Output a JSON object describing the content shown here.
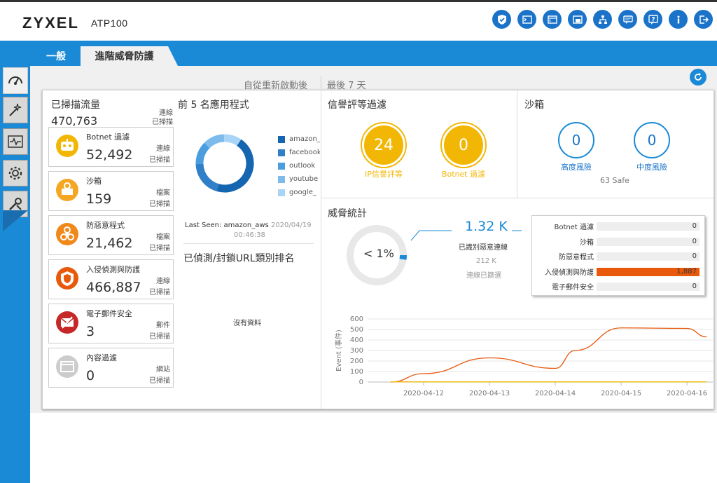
{
  "header": {
    "brand": "ZYXEL",
    "model": "ATP100"
  },
  "top_icons": [
    "shield-check-icon",
    "console-icon",
    "cli-icon",
    "window-icon",
    "network-icon",
    "chat-icon",
    "help-icon",
    "info-icon",
    "logout-icon"
  ],
  "tabs": [
    {
      "label": "一般"
    },
    {
      "label": "進階威脅防護"
    }
  ],
  "sidebar": [
    "dashboard-icon",
    "wizard-icon",
    "monitor-icon",
    "config-icon",
    "maintenance-icon"
  ],
  "toolbar": {
    "since_restart": "自從重新啟動後",
    "period": "最後 7 天"
  },
  "scanned": {
    "title": "已掃描流量",
    "total": "470,763",
    "total_unit": "連線",
    "total_unit2": "已掃描",
    "cards": [
      {
        "name": "Botnet 過濾",
        "value": "52,492",
        "unit": "連線",
        "unit2": "已掃描",
        "color": "#f2b705",
        "icon": "robot-icon"
      },
      {
        "name": "沙箱",
        "value": "159",
        "unit": "檔案",
        "unit2": "已掃描",
        "color": "#f5a623",
        "icon": "sandbox-icon"
      },
      {
        "name": "防惡意程式",
        "value": "21,462",
        "unit": "檔案",
        "unit2": "已掃描",
        "color": "#f0881a",
        "icon": "biohazard-icon"
      },
      {
        "name": "入侵偵測與防護",
        "value": "466,887",
        "unit": "連線",
        "unit2": "已掃描",
        "color": "#e8590c",
        "icon": "ids-shield-icon"
      },
      {
        "name": "電子郵件安全",
        "value": "3",
        "unit": "郵件",
        "unit2": "已掃描",
        "color": "#c62828",
        "icon": "mail-security-icon"
      },
      {
        "name": "內容過濾",
        "value": "0",
        "unit": "網站",
        "unit2": "已掃描",
        "color": "#cccccc",
        "icon": "content-filter-icon"
      }
    ]
  },
  "top_apps": {
    "title": "前 5 名應用程式",
    "legend": [
      {
        "label": "amazon_",
        "color": "#1565b0"
      },
      {
        "label": "facebook",
        "color": "#2f80c8"
      },
      {
        "label": "outlook",
        "color": "#4a9ee0"
      },
      {
        "label": "youtube",
        "color": "#7cbbec"
      },
      {
        "label": "google_",
        "color": "#a9d4f5"
      }
    ],
    "last_seen_label": "Last Seen: amazon_aws",
    "last_seen_date": "2020/04/19",
    "last_seen_time": "00:46:38"
  },
  "url_rank": {
    "title": "已偵測/封鎖URL類別排名",
    "empty": "沒有資料"
  },
  "reputation": {
    "title": "信譽評等過濾",
    "ip_value": "24",
    "ip_label": "IP信譽評等",
    "botnet_value": "0",
    "botnet_label": "Botnet 過濾"
  },
  "sandbox": {
    "title": "沙箱",
    "high_value": "0",
    "high_label": "高度風險",
    "medium_value": "0",
    "medium_label": "中度風險",
    "safe": "63 Safe"
  },
  "threat_stats": {
    "title": "威脅統計",
    "percent": "< 1%",
    "malicious": "1.32 K",
    "malicious_label": "已識別惡意連線",
    "filtered": "212 K",
    "filtered_label": "連線已篩選",
    "bars": [
      {
        "label": "Botnet 過濾",
        "value": "0",
        "fill": 0
      },
      {
        "label": "沙箱",
        "value": "0",
        "fill": 0
      },
      {
        "label": "防惡意程式",
        "value": "0",
        "fill": 0
      },
      {
        "label": "入侵偵測與防護",
        "value": "1,887",
        "fill": 1.0
      },
      {
        "label": "電子郵件安全",
        "value": "0",
        "fill": 0
      }
    ]
  },
  "chart_data": {
    "type": "line",
    "ylabel": "Event (事件)",
    "xlabel": "",
    "ylim": [
      0,
      600
    ],
    "yticks": [
      "0",
      "100",
      "200",
      "300",
      "400",
      "500",
      "600"
    ],
    "categories": [
      "2020-04-12",
      "2020-04-13",
      "2020-04-14",
      "2020-04-15",
      "2020-04-16"
    ],
    "series": [
      {
        "color": "#e8590c",
        "x": [
          -0.5,
          0,
          1,
          2,
          2.3,
          3,
          4,
          4.3
        ],
        "values": [
          0,
          80,
          230,
          130,
          300,
          515,
          510,
          430
        ]
      },
      {
        "color": "#f2b705",
        "x": [
          -0.5,
          4.3
        ],
        "values": [
          2,
          2
        ]
      }
    ]
  }
}
